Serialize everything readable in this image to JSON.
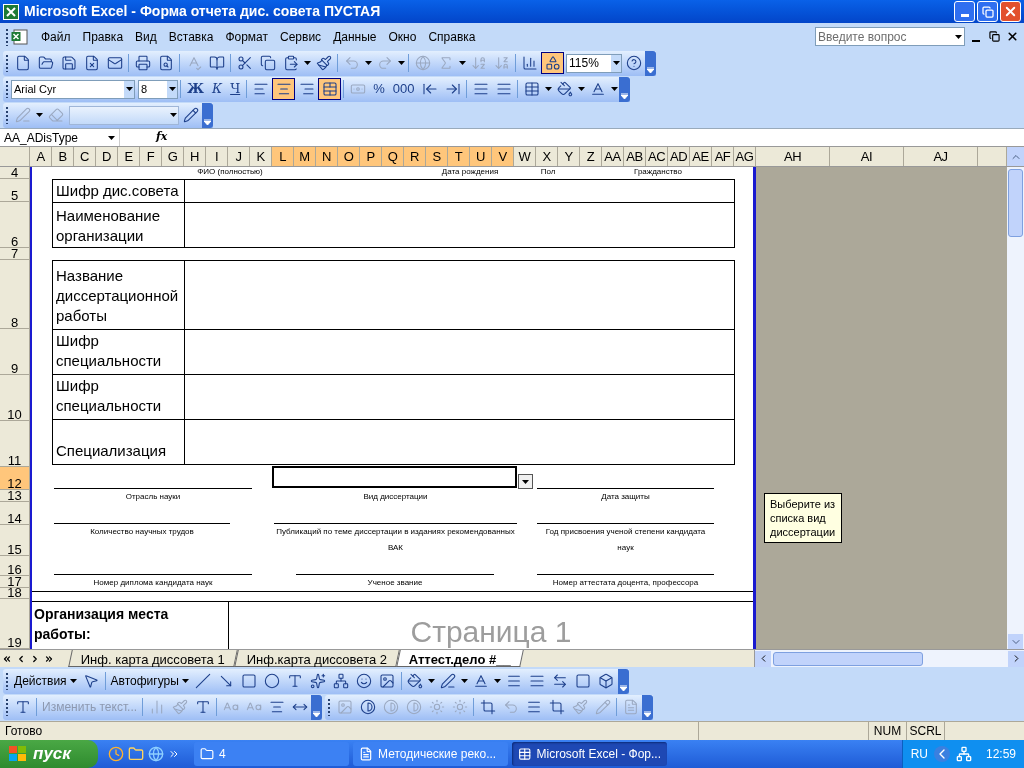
{
  "window": {
    "title": "Microsoft Excel - Форма отчета дис. совета ПУСТАЯ"
  },
  "menu": [
    "Файл",
    "Правка",
    "Вид",
    "Вставка",
    "Формат",
    "Сервис",
    "Данные",
    "Окно",
    "Справка"
  ],
  "help_search": {
    "placeholder": "Введите вопрос"
  },
  "standard_toolbar": {
    "drawing_selected": true,
    "zoom": "115%"
  },
  "formatting_toolbar": {
    "font": "Arial Cyr",
    "size": "8",
    "bold": "Ж",
    "italic": "К",
    "underline": "Ч",
    "align": [
      {
        "selected": false
      },
      {
        "selected": true
      },
      {
        "selected": false
      }
    ],
    "merge_selected": true,
    "percent": "%",
    "thousands": "000"
  },
  "name_box": "AA_ADisType",
  "fx": "fx",
  "columns": [
    {
      "label": "A",
      "selected": false
    },
    {
      "label": "B",
      "selected": false
    },
    {
      "label": "C",
      "selected": false
    },
    {
      "label": "D",
      "selected": false
    },
    {
      "label": "E",
      "selected": false
    },
    {
      "label": "F",
      "selected": false
    },
    {
      "label": "G",
      "selected": false
    },
    {
      "label": "H",
      "selected": false
    },
    {
      "label": "I",
      "selected": false
    },
    {
      "label": "J",
      "selected": false
    },
    {
      "label": "K",
      "selected": false
    },
    {
      "label": "L",
      "selected": true
    },
    {
      "label": "M",
      "selected": true
    },
    {
      "label": "N",
      "selected": true
    },
    {
      "label": "O",
      "selected": true
    },
    {
      "label": "P",
      "selected": true
    },
    {
      "label": "Q",
      "selected": true
    },
    {
      "label": "R",
      "selected": true
    },
    {
      "label": "S",
      "selected": true
    },
    {
      "label": "T",
      "selected": true
    },
    {
      "label": "U",
      "selected": true
    },
    {
      "label": "V",
      "selected": true
    },
    {
      "label": "W",
      "selected": false
    },
    {
      "label": "X",
      "selected": false
    },
    {
      "label": "Y",
      "selected": false
    },
    {
      "label": "Z",
      "selected": false
    },
    {
      "label": "AA",
      "selected": false
    },
    {
      "label": "AB",
      "selected": false
    },
    {
      "label": "AC",
      "selected": false
    },
    {
      "label": "AD",
      "selected": false
    },
    {
      "label": "AE",
      "selected": false
    },
    {
      "label": "AF",
      "selected": false
    },
    {
      "label": "AG",
      "selected": false
    },
    {
      "label": "AH",
      "selected": false
    },
    {
      "label": "AI",
      "selected": false
    },
    {
      "label": "AJ",
      "selected": false
    }
  ],
  "rows": [
    {
      "label": "4",
      "selected": false
    },
    {
      "label": "5",
      "selected": false
    },
    {
      "label": "6",
      "selected": false
    },
    {
      "label": "7",
      "selected": false
    },
    {
      "label": "8",
      "selected": false
    },
    {
      "label": "9",
      "selected": false
    },
    {
      "label": "10",
      "selected": false
    },
    {
      "label": "11",
      "selected": false
    },
    {
      "label": "12",
      "selected": true
    },
    {
      "label": "13",
      "selected": false
    },
    {
      "label": "14",
      "selected": false
    },
    {
      "label": "15",
      "selected": false
    },
    {
      "label": "16",
      "selected": false
    },
    {
      "label": "17",
      "selected": false
    },
    {
      "label": "18",
      "selected": false
    },
    {
      "label": "19",
      "selected": false
    }
  ],
  "person_captions": [
    "ФИО (полностью)",
    "Дата рождения",
    "Пол",
    "Гражданство"
  ],
  "table_1": [
    "Шифр дис.совета",
    "Наименование организации"
  ],
  "table_2": [
    "Название диссертационной работы",
    "Шифр специальности",
    "Шифр специальности",
    "Специализация"
  ],
  "captions": [
    [
      "Отрасль науки",
      "Вид диссертации",
      "Дата  защиты"
    ],
    [
      "Количество научных трудов",
      "Публикаций по теме диссертации в изданиях рекомендованных ВАК",
      "Год присвоения ученой степени кандидата наук"
    ],
    [
      "Номер диплома кандидата наук",
      "Ученое звание",
      "Номер аттестата доцента, профессора"
    ]
  ],
  "tooltip": "Выберите из списка вид диссертации",
  "work_org": "Организация места работы:",
  "page_label": "Страница 1",
  "sheet_tabs": [
    {
      "label": "Инф. карта диссовета 1",
      "selected": false
    },
    {
      "label": "Инф.карта диссовета 2",
      "selected": false
    },
    {
      "label": "Аттест.дело #__",
      "selected": true
    }
  ],
  "drawing_toolbar": {
    "actions": "Действия",
    "autoshapes": "Автофигуры"
  },
  "wordart_toolbar": {
    "edit_text": {
      "label": "Изменить текст...",
      "disabled": true
    }
  },
  "status_bar": {
    "text": "Готово",
    "indicators": [
      "NUM",
      "SCRL"
    ]
  },
  "taskbar": {
    "start": "пуск",
    "tasks": [
      {
        "label": "4",
        "selected": false
      },
      {
        "label": "Методические реко...",
        "selected": false
      },
      {
        "label": "Microsoft Excel - Фор...",
        "selected": true
      }
    ],
    "language": "RU",
    "clock": "12:59"
  }
}
